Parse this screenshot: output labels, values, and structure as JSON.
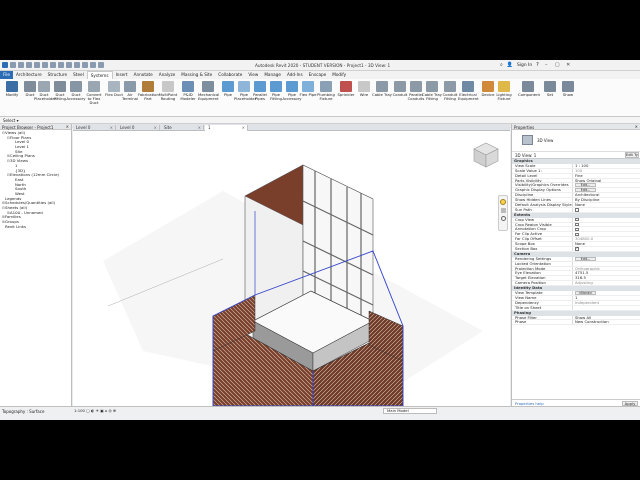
{
  "titlebar": {
    "title": "Autodesk Revit 2020 - STUDENT VERSION - Project1 - 3D View: 1",
    "sign_in": "Sign In"
  },
  "tabs": [
    "File",
    "Architecture",
    "Structure",
    "Steel",
    "Systems",
    "Insert",
    "Annotate",
    "Analyze",
    "Massing & Site",
    "Collaborate",
    "View",
    "Manage",
    "Add-Ins",
    "Enscape",
    "Modify"
  ],
  "active_tab": "Systems",
  "ribbon": {
    "buttons": [
      {
        "label": "Modify",
        "color": "#3a6ea5"
      },
      {
        "label": "Duct",
        "color": "#7f8c99"
      },
      {
        "label": "Duct Placeholder",
        "color": "#9aa6b2"
      },
      {
        "label": "Duct Fitting",
        "color": "#7f8c99"
      },
      {
        "label": "Duct Accessory",
        "color": "#8796a5"
      },
      {
        "label": "Convert to Flex Duct",
        "color": "#9aa6b2"
      },
      {
        "label": "Flex Duct",
        "color": "#a8b4bf"
      },
      {
        "label": "Air Terminal",
        "color": "#8a9aab"
      },
      {
        "label": "Fabrication Part",
        "color": "#b07e3a"
      },
      {
        "label": "MultiPoint Routing",
        "color": "#c8c8c8"
      },
      {
        "label": "P&ID Modeler",
        "color": "#6b8fb5"
      },
      {
        "label": "Mechanical Equipment",
        "color": "#7d8e9e"
      },
      {
        "label": "Pipe",
        "color": "#5c9bd1"
      },
      {
        "label": "Pipe Placeholder",
        "color": "#8fb6d9"
      },
      {
        "label": "Parallel Pipes",
        "color": "#5c9bd1"
      },
      {
        "label": "Pipe Fitting",
        "color": "#5c9bd1"
      },
      {
        "label": "Pipe Accessory",
        "color": "#5c9bd1"
      },
      {
        "label": "Flex Pipe",
        "color": "#7fb0da"
      },
      {
        "label": "Plumbing Fixture",
        "color": "#8aa0b5"
      },
      {
        "label": "Sprinkler",
        "color": "#c0504d"
      },
      {
        "label": "Wire",
        "color": "#c8c8c8"
      },
      {
        "label": "Cable Tray",
        "color": "#8c9aa7"
      },
      {
        "label": "Conduit",
        "color": "#8c9aa7"
      },
      {
        "label": "Parallel Conduits",
        "color": "#8c9aa7"
      },
      {
        "label": "Cable Tray Fitting",
        "color": "#8c9aa7"
      },
      {
        "label": "Conduit Fitting",
        "color": "#8c9aa7"
      },
      {
        "label": "Electrical Equipment",
        "color": "#6f8aa5"
      },
      {
        "label": "Device",
        "color": "#d08a3a"
      },
      {
        "label": "Lighting Fixture",
        "color": "#e0b84a"
      },
      {
        "label": "Component",
        "color": "#7a8a9a"
      },
      {
        "label": "Set",
        "color": "#7a8a9a"
      },
      {
        "label": "Show",
        "color": "#7a8a9a"
      }
    ],
    "panels": [
      "Select",
      "HVAC",
      "Fabrication",
      "P&ID Collaboration",
      "Mechanical",
      "Plumbing & Piping",
      "Electrical",
      "Model",
      "Work Plane"
    ]
  },
  "browser": {
    "title": "Project Browser - Project1",
    "close": "×",
    "nodes": [
      {
        "t": "⊟",
        "label": "Views (all)",
        "indent": 0,
        "icon": "views-icon"
      },
      {
        "t": "⊟",
        "label": "Floor Plans",
        "indent": 1,
        "icon": ""
      },
      {
        "t": "",
        "label": "Level 0",
        "indent": 2,
        "icon": ""
      },
      {
        "t": "",
        "label": "Level 1",
        "indent": 2,
        "icon": ""
      },
      {
        "t": "",
        "label": "Site",
        "indent": 2,
        "icon": ""
      },
      {
        "t": "⊞",
        "label": "Ceiling Plans",
        "indent": 1,
        "icon": ""
      },
      {
        "t": "⊟",
        "label": "3D Views",
        "indent": 1,
        "icon": ""
      },
      {
        "t": "",
        "label": "1",
        "indent": 2,
        "icon": ""
      },
      {
        "t": "",
        "label": "{3D}",
        "indent": 2,
        "icon": ""
      },
      {
        "t": "⊟",
        "label": "Elevations (12mm Circle)",
        "indent": 1,
        "icon": ""
      },
      {
        "t": "",
        "label": "East",
        "indent": 2,
        "icon": ""
      },
      {
        "t": "",
        "label": "North",
        "indent": 2,
        "icon": ""
      },
      {
        "t": "",
        "label": "South",
        "indent": 2,
        "icon": ""
      },
      {
        "t": "",
        "label": "West",
        "indent": 2,
        "icon": ""
      },
      {
        "t": "",
        "label": "Legends",
        "indent": 0,
        "icon": "legend-icon"
      },
      {
        "t": "⊞",
        "label": "Schedules/Quantities (all)",
        "indent": 0,
        "icon": "schedule-icon"
      },
      {
        "t": "⊟",
        "label": "Sheets (all)",
        "indent": 0,
        "icon": "sheet-icon"
      },
      {
        "t": "⊞",
        "label": "A100 - Unnamed",
        "indent": 1,
        "icon": ""
      },
      {
        "t": "⊞",
        "label": "Families",
        "indent": 0,
        "icon": "family-icon"
      },
      {
        "t": "⊞",
        "label": "Groups",
        "indent": 0,
        "icon": "group-icon"
      },
      {
        "t": "",
        "label": "Revit Links",
        "indent": 0,
        "icon": "link-icon"
      }
    ]
  },
  "view_tabs": [
    "Level 0",
    "Level 0",
    "Site",
    "1"
  ],
  "properties": {
    "title": "Properties",
    "close": "×",
    "type_label": "3D View",
    "type_selector": "3D View: 1",
    "edit_type": "Edit Type",
    "sections": [
      {
        "name": "Graphics",
        "rows": [
          [
            "View Scale",
            "1 : 100",
            ""
          ],
          [
            "Scale Value  1:",
            "100",
            "dim"
          ],
          [
            "Detail Level",
            "Fine",
            ""
          ],
          [
            "Parts Visibility",
            "Show Original",
            ""
          ],
          [
            "Visibility/Graphics Overrides",
            "Edit...",
            "btn"
          ],
          [
            "Graphic Display Options",
            "Edit...",
            "btn"
          ],
          [
            "Discipline",
            "Architectural",
            ""
          ],
          [
            "Show Hidden Lines",
            "By Discipline",
            ""
          ],
          [
            "Default Analysis Display Style",
            "None",
            ""
          ],
          [
            "Sun Path",
            "",
            "cb"
          ]
        ]
      },
      {
        "name": "Extents",
        "rows": [
          [
            "Crop View",
            "",
            "cb"
          ],
          [
            "Crop Region Visible",
            "",
            "cb"
          ],
          [
            "Annotation Crop",
            "",
            "cb"
          ],
          [
            "Far Clip Active",
            "",
            "cb"
          ],
          [
            "Far Clip Offset",
            "304800.0",
            "dim"
          ],
          [
            "Scope Box",
            "None",
            ""
          ],
          [
            "Section Box",
            "",
            "cbon"
          ]
        ]
      },
      {
        "name": "Camera",
        "rows": [
          [
            "Rendering Settings",
            "Edit...",
            "btn"
          ],
          [
            "Locked Orientation",
            "",
            "dim"
          ],
          [
            "Projection Mode",
            "Orthographic",
            "dim"
          ],
          [
            "Eye Elevation",
            "4751.5",
            ""
          ],
          [
            "Target Elevation",
            "316.5",
            ""
          ],
          [
            "Camera Position",
            "Adjusting",
            "dim"
          ]
        ]
      },
      {
        "name": "Identity Data",
        "rows": [
          [
            "View Template",
            "<None>",
            "btn"
          ],
          [
            "View Name",
            "1",
            ""
          ],
          [
            "Dependency",
            "Independent",
            "dim"
          ],
          [
            "Title on Sheet",
            "",
            ""
          ]
        ]
      },
      {
        "name": "Phasing",
        "rows": [
          [
            "Phase Filter",
            "Show All",
            ""
          ],
          [
            "Phase",
            "New Construction",
            ""
          ]
        ]
      }
    ],
    "help_link": "Properties help",
    "apply": "Apply"
  },
  "status": {
    "text": "Topography : Surface",
    "model": "Main Model"
  },
  "colors": {
    "accent": "#2b6cb5",
    "brick": "#7a3f2b",
    "brick_line": "#d8c4b4",
    "frame": "#3344cc"
  }
}
